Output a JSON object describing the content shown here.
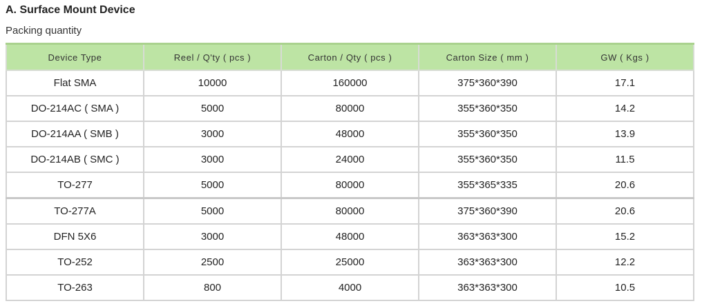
{
  "section_title": "A. Surface Mount Device",
  "subtitle": "Packing quantity",
  "table": {
    "headers": [
      "Device Type",
      "Reel / Q'ty ( pcs )",
      "Carton / Qty ( pcs )",
      "Carton Size ( mm )",
      "GW ( Kgs )"
    ],
    "rows": [
      [
        "Flat  SMA",
        "10000",
        "160000",
        "375*360*390",
        "17.1"
      ],
      [
        "DO-214AC ( SMA )",
        "5000",
        "80000",
        "355*360*350",
        "14.2"
      ],
      [
        "DO-214AA ( SMB )",
        "3000",
        "48000",
        "355*360*350",
        "13.9"
      ],
      [
        "DO-214AB ( SMC )",
        "3000",
        "24000",
        "355*360*350",
        "11.5"
      ],
      [
        "TO-277",
        "5000",
        "80000",
        "355*365*335",
        "20.6"
      ],
      [
        "TO-277A",
        "5000",
        "80000",
        "375*360*390",
        "20.6"
      ],
      [
        "DFN  5X6",
        "3000",
        "48000",
        "363*363*300",
        "15.2"
      ],
      [
        "TO-252",
        "2500",
        "25000",
        "363*363*300",
        "12.2"
      ],
      [
        "TO-263",
        "800",
        "4000",
        "363*363*300",
        "10.5"
      ]
    ]
  },
  "colors": {
    "header_background": "#bde4a4",
    "grid_border": "#d3d3d3"
  }
}
